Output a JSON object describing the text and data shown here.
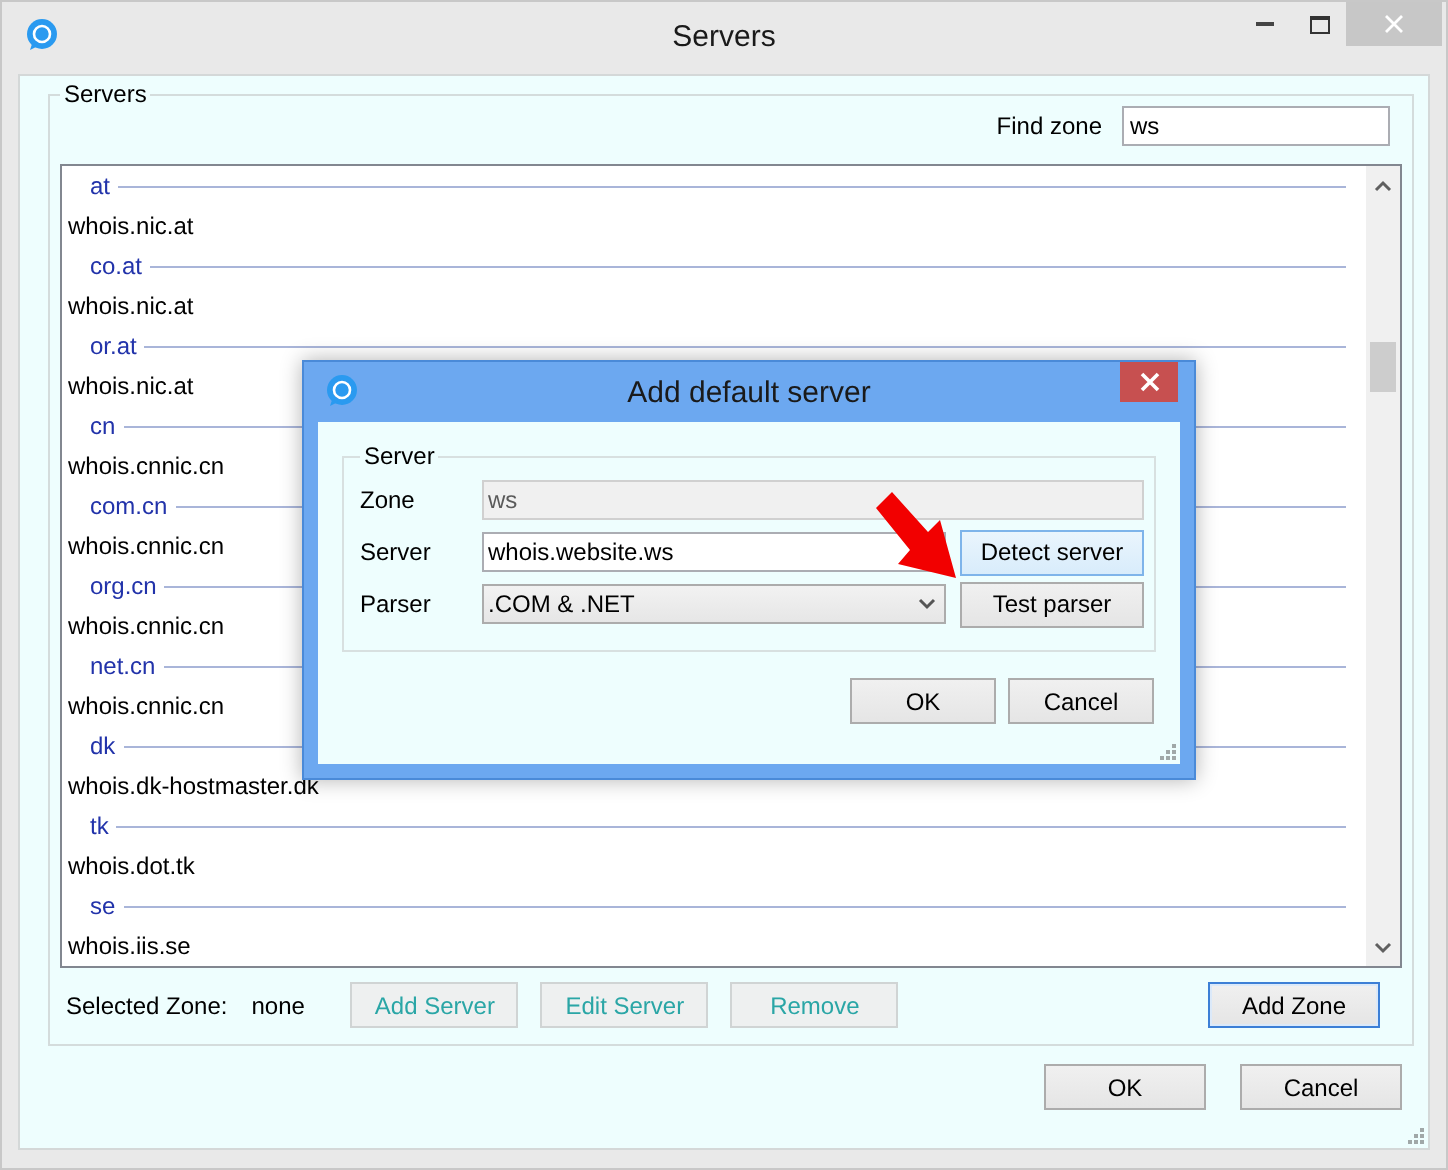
{
  "window": {
    "title": "Servers"
  },
  "group": {
    "label": "Servers"
  },
  "find_zone": {
    "label": "Find zone",
    "value": "ws"
  },
  "zones": [
    {
      "zone": "at",
      "servers": [
        "whois.nic.at"
      ]
    },
    {
      "zone": "co.at",
      "servers": [
        "whois.nic.at"
      ]
    },
    {
      "zone": "or.at",
      "servers": [
        "whois.nic.at"
      ]
    },
    {
      "zone": "cn",
      "servers": [
        "whois.cnnic.cn"
      ]
    },
    {
      "zone": "com.cn",
      "servers": [
        "whois.cnnic.cn"
      ]
    },
    {
      "zone": "org.cn",
      "servers": [
        "whois.cnnic.cn"
      ]
    },
    {
      "zone": "net.cn",
      "servers": [
        "whois.cnnic.cn"
      ]
    },
    {
      "zone": "dk",
      "servers": [
        "whois.dk-hostmaster.dk"
      ]
    },
    {
      "zone": "tk",
      "servers": [
        "whois.dot.tk"
      ]
    },
    {
      "zone": "se",
      "servers": [
        "whois.iis.se"
      ]
    }
  ],
  "selected_zone": {
    "label": "Selected Zone:",
    "value": "none"
  },
  "zone_buttons": [
    {
      "label": "Add Server",
      "disabled": true,
      "focused": false
    },
    {
      "label": "Edit Server",
      "disabled": true,
      "focused": false
    },
    {
      "label": "Remove",
      "disabled": true,
      "focused": false
    },
    {
      "label": "Add Zone",
      "disabled": false,
      "focused": true
    }
  ],
  "buttons": [
    {
      "label": "OK"
    },
    {
      "label": "Cancel"
    }
  ],
  "dialog": {
    "title": "Add default server",
    "group_label": "Server",
    "fields": [
      {
        "kind": "text",
        "label": "Zone",
        "value": "ws",
        "disabled": true
      },
      {
        "kind": "text",
        "label": "Server",
        "value": "whois.website.ws",
        "disabled": false,
        "button": {
          "label": "Detect server",
          "hovered": true
        }
      },
      {
        "kind": "select",
        "label": "Parser",
        "value": ".COM & .NET",
        "disabled": false,
        "button": {
          "label": "Test parser",
          "hovered": false
        }
      }
    ],
    "buttons": [
      {
        "label": "OK"
      },
      {
        "label": "Cancel"
      }
    ]
  }
}
